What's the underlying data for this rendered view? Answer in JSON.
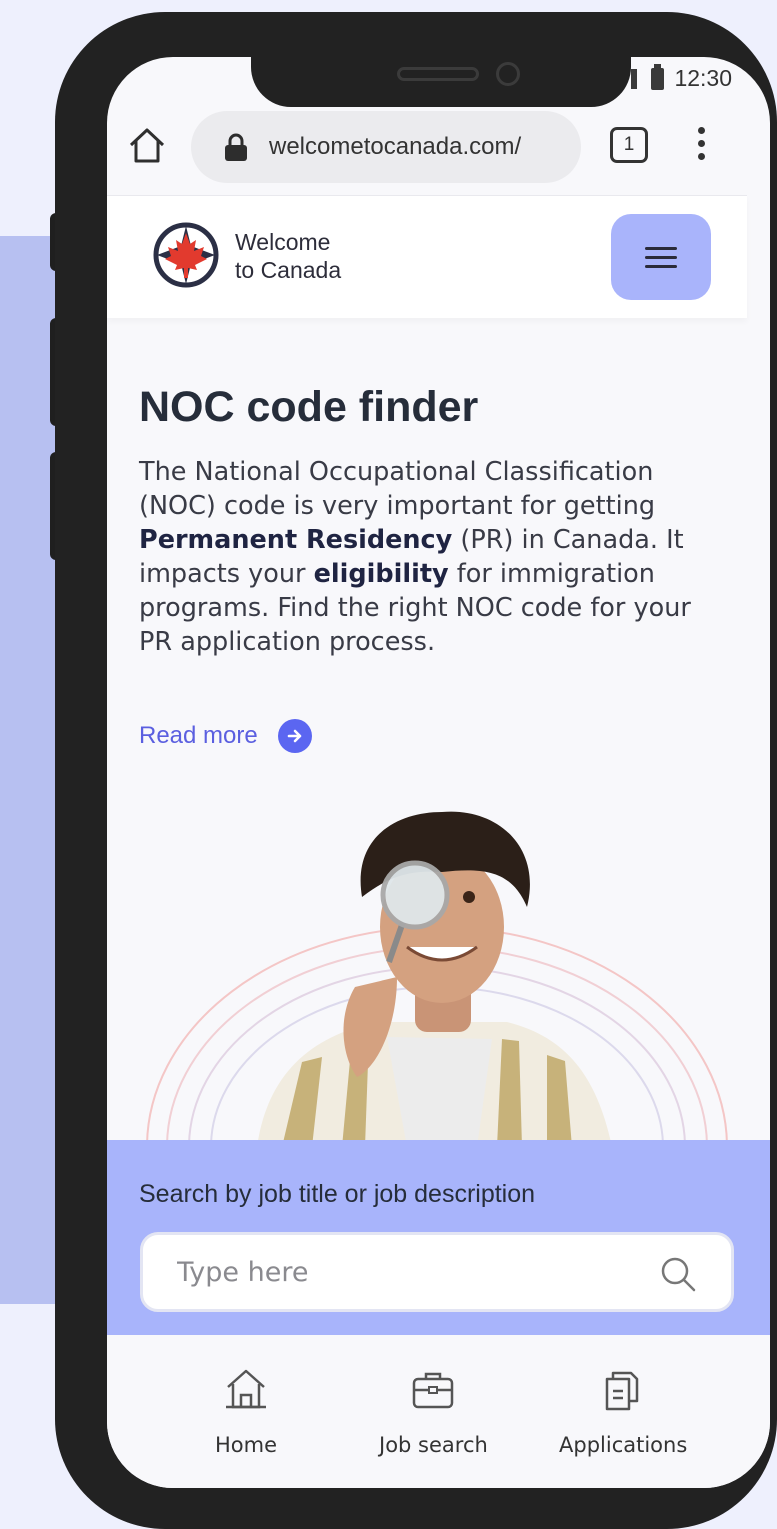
{
  "status_bar": {
    "time": "12:30"
  },
  "browser": {
    "url": "welcometocanada.com/",
    "tab_count": "1",
    "icons": [
      "home-icon",
      "lock-icon",
      "kebab-menu-icon"
    ]
  },
  "site": {
    "brand_line1": "Welcome",
    "brand_line2": "to Canada",
    "menu_icon": "hamburger-icon"
  },
  "hero": {
    "title": "NOC code finder",
    "desc_1": "The National Occupational Classification (NOC) code is very important for getting ",
    "desc_bold_1": "Permanent Residency",
    "desc_2": " (PR) in Canada. It impacts your ",
    "desc_bold_2": "eligibility",
    "desc_3": " for immigration programs. Find the right NOC code for your PR application process.",
    "read_more": "Read more"
  },
  "search": {
    "label": "Search by job title or job description",
    "placeholder": "Type here",
    "value": ""
  },
  "bottom_nav": [
    {
      "label": "Home",
      "icon": "home-icon"
    },
    {
      "label": "Job search",
      "icon": "briefcase-icon"
    },
    {
      "label": "Applications",
      "icon": "documents-icon"
    }
  ],
  "colors": {
    "accent": "#a8b4fb",
    "link": "#5b5fe0",
    "background": "#eef0fd",
    "phone": "#222222"
  }
}
